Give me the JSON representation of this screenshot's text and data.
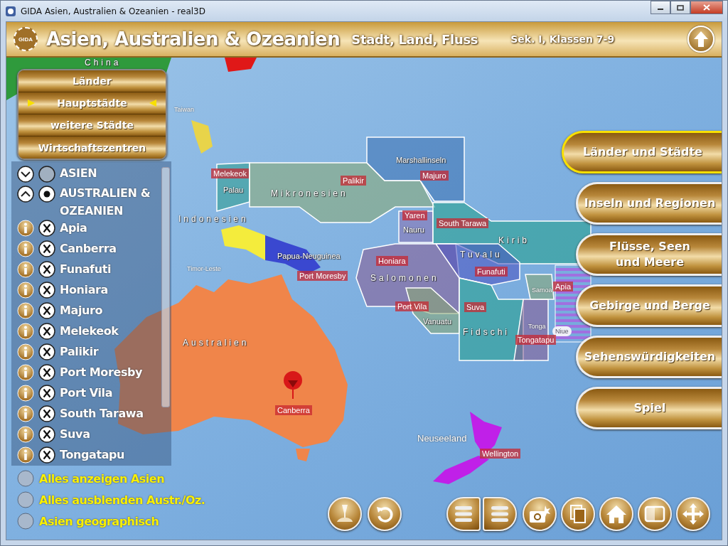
{
  "window": {
    "title": "GIDA Asien, Australien & Ozeanien - real3D"
  },
  "header": {
    "logo": "GIDA",
    "title": "Asien, Australien & Ozeanien",
    "subtitle": "Stadt, Land, Fluss",
    "grade": "Sek. I, Klassen 7-9"
  },
  "layer_menu": [
    {
      "label": "Länder",
      "selected": false
    },
    {
      "label": "Hauptstädte",
      "selected": true
    },
    {
      "label": "weitere Städte",
      "selected": false
    },
    {
      "label": "Wirtschaftszentren",
      "selected": false
    }
  ],
  "tree": [
    {
      "label": "ASIEN",
      "expanded": false,
      "selected": false
    },
    {
      "label": "AUSTRALIEN & OZEANIEN",
      "expanded": true,
      "selected": true,
      "children": [
        {
          "label": "Apia"
        },
        {
          "label": "Canberra"
        },
        {
          "label": "Funafuti"
        },
        {
          "label": "Honiara"
        },
        {
          "label": "Majuro"
        },
        {
          "label": "Melekeok"
        },
        {
          "label": "Palikir"
        },
        {
          "label": "Port Moresby"
        },
        {
          "label": "Port Vila"
        },
        {
          "label": "South Tarawa"
        },
        {
          "label": "Suva"
        },
        {
          "label": "Tongatapu"
        }
      ]
    }
  ],
  "options": [
    {
      "label": "Alles anzeigen Asien",
      "selected": false
    },
    {
      "label": "Alles ausblenden Austr./Oz.",
      "selected": false
    },
    {
      "label": "Asien geographisch",
      "selected": false
    }
  ],
  "nav": [
    {
      "label": "Länder und Städte",
      "selected": true
    },
    {
      "label": "Inseln und Regionen",
      "selected": false
    },
    {
      "label": "Flüsse, Seen\nund Meere",
      "selected": false
    },
    {
      "label": "Gebirge und Berge",
      "selected": false
    },
    {
      "label": "Sehenswürdigkeiten",
      "selected": false
    },
    {
      "label": "Spiel",
      "selected": false
    }
  ],
  "map": {
    "labels": [
      {
        "text": "China",
        "kind": "area"
      },
      {
        "text": "Taiwan",
        "kind": "small"
      },
      {
        "text": "Indonesien",
        "kind": "area"
      },
      {
        "text": "Timor-Leste",
        "kind": "small"
      },
      {
        "text": "Melekeok",
        "kind": "capital"
      },
      {
        "text": "Palau",
        "kind": "country"
      },
      {
        "text": "Mikronesien",
        "kind": "area"
      },
      {
        "text": "Palikir",
        "kind": "capital"
      },
      {
        "text": "Marshallinseln",
        "kind": "country"
      },
      {
        "text": "Majuro",
        "kind": "capital"
      },
      {
        "text": "Yaren",
        "kind": "capital"
      },
      {
        "text": "Nauru",
        "kind": "country"
      },
      {
        "text": "South Tarawa",
        "kind": "capital"
      },
      {
        "text": "Kirib",
        "kind": "area"
      },
      {
        "text": "Papua-Neuguinea",
        "kind": "country"
      },
      {
        "text": "Port Moresby",
        "kind": "capital"
      },
      {
        "text": "Honiara",
        "kind": "capital"
      },
      {
        "text": "Salomonen",
        "kind": "area"
      },
      {
        "text": "Tuvalu",
        "kind": "area"
      },
      {
        "text": "Funafuti",
        "kind": "capital"
      },
      {
        "text": "Samoa",
        "kind": "small"
      },
      {
        "text": "Apia",
        "kind": "capital"
      },
      {
        "text": "Port Vila",
        "kind": "capital"
      },
      {
        "text": "Vanuatu",
        "kind": "country"
      },
      {
        "text": "Suva",
        "kind": "capital"
      },
      {
        "text": "Fidschi",
        "kind": "area"
      },
      {
        "text": "Tonga",
        "kind": "small"
      },
      {
        "text": "Niue",
        "kind": "island"
      },
      {
        "text": "Tongatapu",
        "kind": "capital"
      },
      {
        "text": "Australien",
        "kind": "area"
      },
      {
        "text": "Canberra",
        "kind": "capital"
      },
      {
        "text": "Neuseeland",
        "kind": "large"
      },
      {
        "text": "Wellington",
        "kind": "capital"
      }
    ]
  }
}
